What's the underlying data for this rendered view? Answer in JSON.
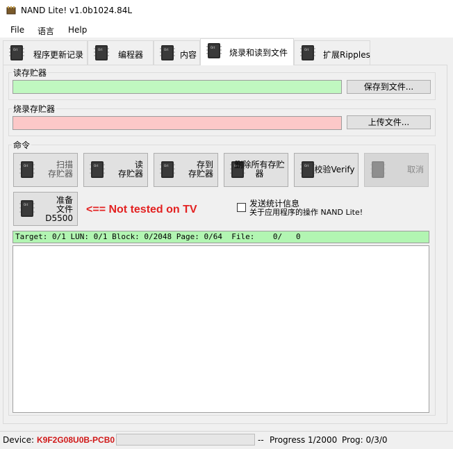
{
  "window": {
    "title": "NAND Lite! v1.0b1024.84L"
  },
  "menu": [
    "File",
    "语言",
    "Help"
  ],
  "tabs": [
    "程序更新记录",
    "编程器",
    "内容",
    "烧录和读到文件",
    "扩展Ripples"
  ],
  "read_section": {
    "label": "读存贮器",
    "button": "保存到文件..."
  },
  "write_section": {
    "label": "烧录存贮器",
    "button": "上传文件..."
  },
  "commands": {
    "label": "命令",
    "buttons": [
      "扫描\n存贮器",
      "读\n存贮器",
      "存到\n存贮器",
      "删除所有存贮器",
      "校验Verify",
      "取消"
    ],
    "prepare": "准备\n文件\nD5500"
  },
  "warning": "<== Not tested on TV",
  "checkbox": {
    "line1": "发送统计信息",
    "line2": "关于应用程序的操作 NAND Lite!"
  },
  "status_line": "Target: 0/1 LUN: 0/1 Block: 0/2048 Page: 0/64  File:    0/   0",
  "bottom": {
    "device_label": "Device:",
    "device_value": "K9F2G08U0B-PCB0",
    "sep": "--",
    "progress": "Progress 1/2000",
    "prog": "Prog: 0/3/0"
  },
  "progress_fraction": 0.0,
  "colors": {
    "read_bar": "#c0f8c0",
    "write_bar": "#fcc8c8",
    "status_bg": "#b2f5b2",
    "warning": "#e32121",
    "device": "#d01818"
  },
  "icons": [
    "app-chip-icon",
    "chip-icon"
  ]
}
